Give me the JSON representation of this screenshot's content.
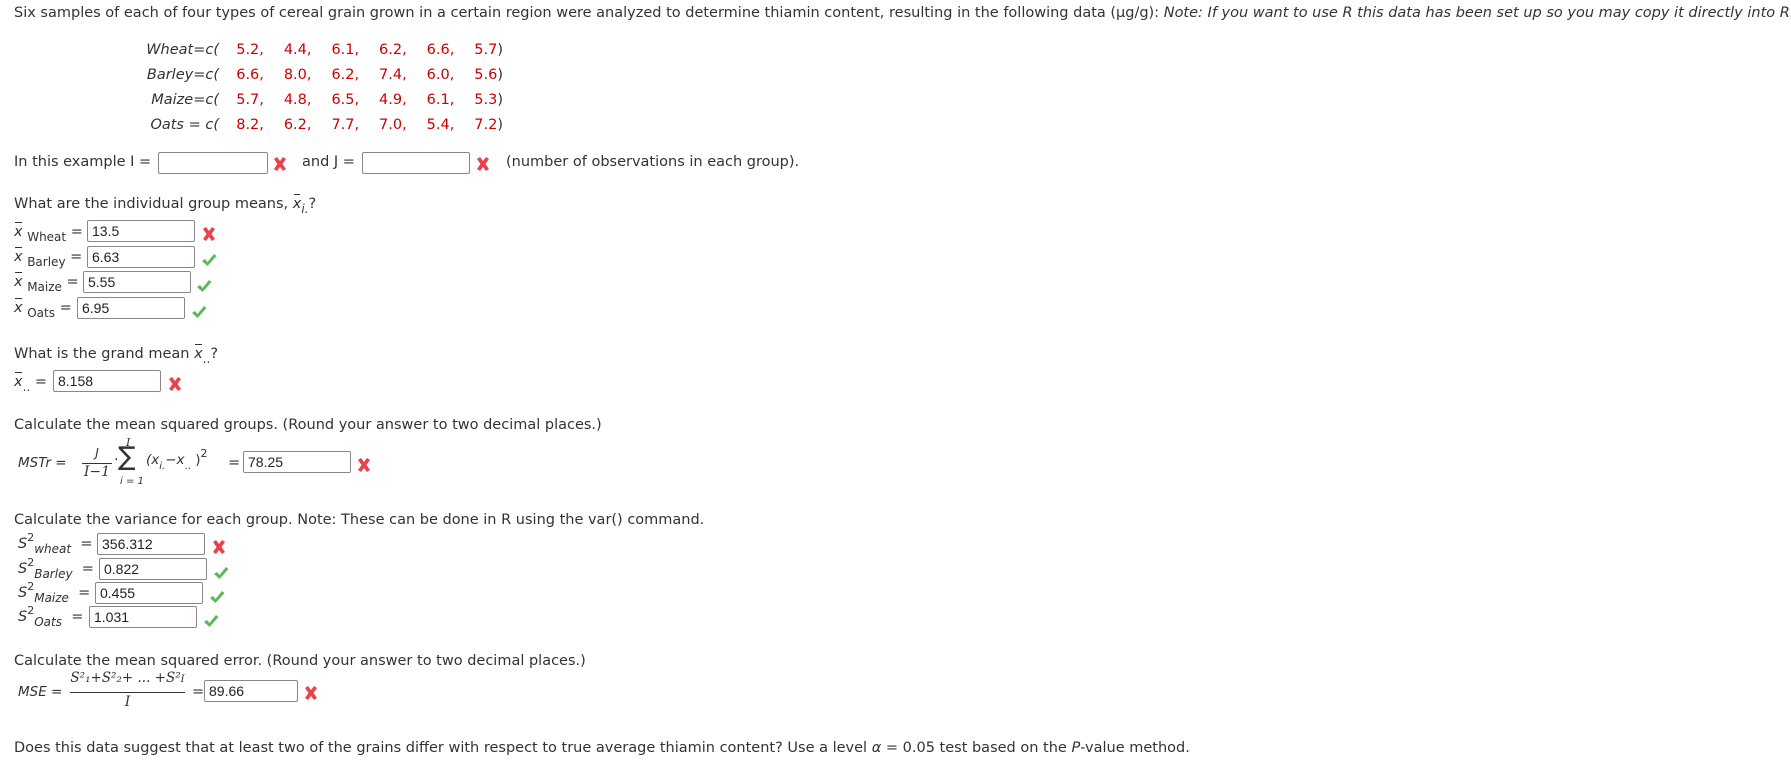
{
  "intro": {
    "text": "Six samples of each of four types of cereal grain grown in a certain region were analyzed to determine thiamin content, resulting in the following data (µg/g):",
    "note": "Note: If you want to use R this data has been set up so you may copy it directly into R."
  },
  "data_rows": [
    {
      "label": "Wheat=c(",
      "values": [
        "5.2,",
        "4.4,",
        "6.1,",
        "6.2,",
        "6.6,",
        "5.7"
      ]
    },
    {
      "label": "Barley=c(",
      "values": [
        "6.6,",
        "8.0,",
        "6.2,",
        "7.4,",
        "6.0,",
        "5.6"
      ]
    },
    {
      "label": "Maize=c(",
      "values": [
        "5.7,",
        "4.8,",
        "6.5,",
        "4.9,",
        "6.1,",
        "5.3"
      ]
    },
    {
      "label": "Oats = c(",
      "values": [
        "8.2,",
        "6.2,",
        "7.7,",
        "7.0,",
        "5.4,",
        "7.2"
      ]
    }
  ],
  "close_paren": ")",
  "ij": {
    "prefix": "In this example I =",
    "i_value": "",
    "i_status": "incorrect",
    "mid": "and J =",
    "j_value": "",
    "j_status": "incorrect",
    "suffix": "(number of observations in each group)."
  },
  "means": {
    "question": "What are the individual group means,",
    "question_symbol": "x",
    "question_sub": "i.",
    "question_end": "?",
    "symbol": "x",
    "equals": "=",
    "rows": [
      {
        "label": "Wheat",
        "value": "13.5",
        "status": "incorrect"
      },
      {
        "label": "Barley",
        "value": "6.63",
        "status": "correct"
      },
      {
        "label": "Maize",
        "value": "5.55",
        "status": "correct"
      },
      {
        "label": "Oats",
        "value": "6.95",
        "status": "correct"
      }
    ]
  },
  "grand_mean": {
    "question": "What is the grand mean",
    "symbol": "x",
    "sub": "..",
    "question_end": "?",
    "equals": "=",
    "value": "8.158",
    "status": "incorrect"
  },
  "mstr": {
    "question": "Calculate the mean squared groups. (Round your answer to two decimal places.)",
    "label": "MSTr =",
    "numerator": "J",
    "denominator": "I−1",
    "dot": "·",
    "sigma": "∑",
    "sigma_top": "I",
    "sigma_bottom": "i = 1",
    "term": "(x",
    "term_sub1": "i.",
    "term_mid": "−x",
    "term_sub2": "..",
    "term_end": ")",
    "power": "2",
    "equals": "=",
    "value": "78.25",
    "status": "incorrect"
  },
  "variance": {
    "question": "Calculate the variance for each group. Note: These can be done in R using the var() command.",
    "symbol": "S",
    "power": "2",
    "equals": "=",
    "rows": [
      {
        "label": "wheat",
        "value": "356.312",
        "status": "incorrect"
      },
      {
        "label": "Barley",
        "value": "0.822",
        "status": "correct"
      },
      {
        "label": "Maize",
        "value": "0.455",
        "status": "correct"
      },
      {
        "label": "Oats",
        "value": "1.031",
        "status": "correct"
      }
    ]
  },
  "mse": {
    "question": "Calculate the mean squared error. (Round your answer to two decimal places.)",
    "label": "MSE =",
    "numerator": "S²₁+S²₂+ ... +S²",
    "numerator_sub": "I",
    "denominator": "I",
    "equals": "=",
    "value": "89.66",
    "status": "incorrect"
  },
  "final": {
    "text1": "Does this data suggest that at least two of the grains differ with respect to true average thiamin content? Use a level",
    "alpha": "α",
    "text2": "= 0.05 test based on the",
    "p": "P",
    "text3": "-value method."
  },
  "colors": {
    "incorrect": "#e8424a",
    "correct": "#5cb85c",
    "data_value": "#cc0000"
  }
}
